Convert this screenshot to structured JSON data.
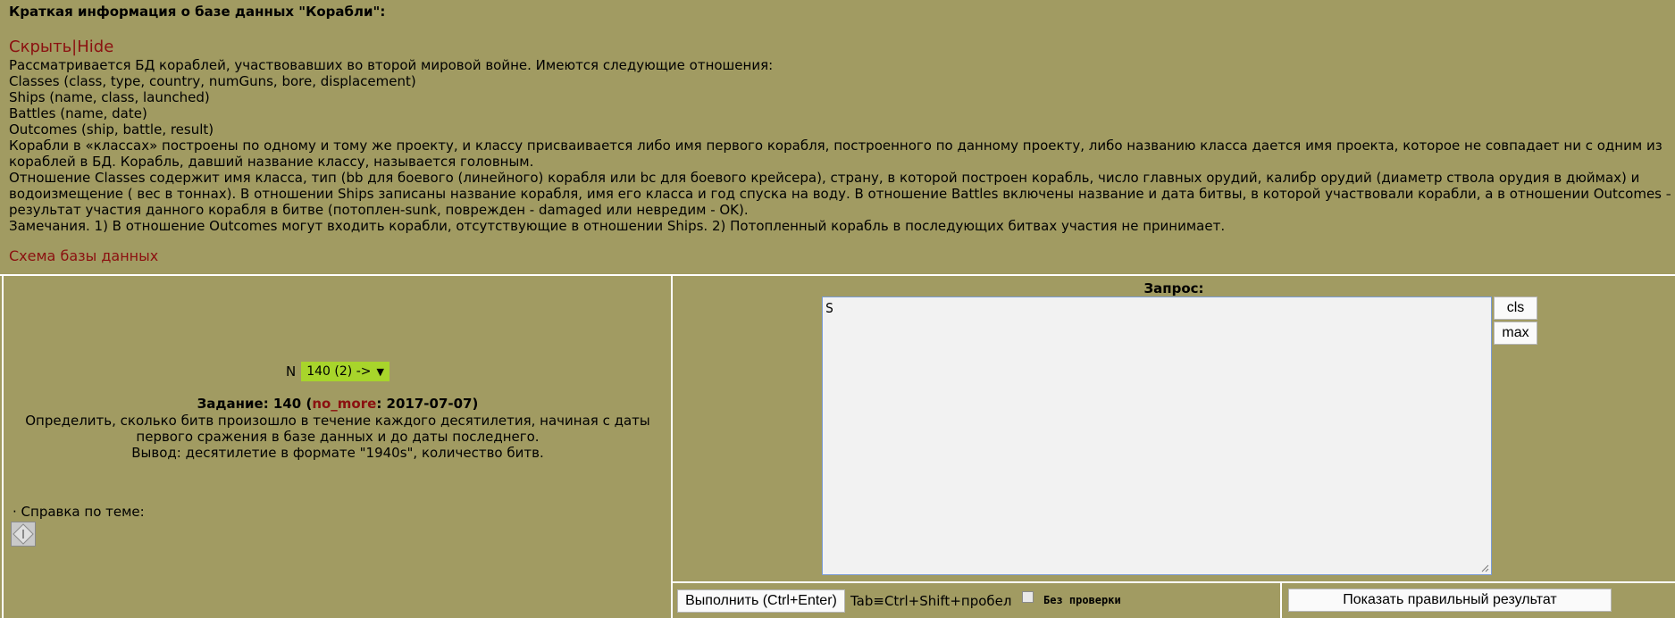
{
  "info": {
    "heading": "Краткая информация о базе данных \"Корабли\":",
    "hide_link": "Скрыть|Hide",
    "lines": [
      "Рассматривается БД кораблей, участвовавших во второй мировой войне. Имеются следующие отношения:",
      "Classes (class, type, country, numGuns, bore, displacement)",
      "Ships (name, class, launched)",
      "Battles (name, date)",
      "Outcomes (ship, battle, result)",
      "Корабли в «классах» построены по одному и тому же проекту, и классу присваивается либо имя первого корабля, построенного по данному проекту, либо названию класса дается имя проекта, которое не совпадает ни с одним из",
      "кораблей в БД. Корабль, давший название классу, называется головным.",
      "Отношение Classes содержит имя класса, тип (bb для боевого (линейного) корабля или bc для боевого крейсера), страну, в которой построен корабль, число главных орудий, калибр орудий (диаметр ствола орудия в дюймах) и",
      "водоизмещение ( вес в тоннах). В отношении Ships записаны название корабля, имя его класса и год спуска на воду. В отношение Battles включены название и дата битвы, в которой участвовали корабли, а в отношении Outcomes –",
      "результат участия данного корабля в битве (потоплен-sunk, поврежден - damaged или невредим - OK).",
      "Замечания. 1) В отношение Outcomes могут входить корабли, отсутствующие в отношении Ships. 2) Потопленный корабль в последующих битвах участия не принимает."
    ],
    "schema_link": "Схема базы данных"
  },
  "task": {
    "n_label": "N",
    "selected": "140 (2) ->",
    "title_prefix": "Задание: 140 (",
    "author": "no_more",
    "title_suffix": ": 2017-07-07)",
    "desc_lines": [
      "Определить, сколько битв произошло в течение каждого десятилетия, начиная с даты",
      "первого сражения в базе данных и до даты последнего.",
      "Вывод: десятилетие в формате \"1940s\", количество битв."
    ],
    "help_label": "· Справка по теме:"
  },
  "query": {
    "label": "Запрос:",
    "value": "S",
    "cls_label": "cls",
    "max_label": "max",
    "run_label": "Выполнить (Ctrl+Enter)",
    "tab_hint": "Tab≡Ctrl+Shift+пробел",
    "nocheck_label": "Без проверки",
    "show_label": "Показать правильный результат"
  }
}
